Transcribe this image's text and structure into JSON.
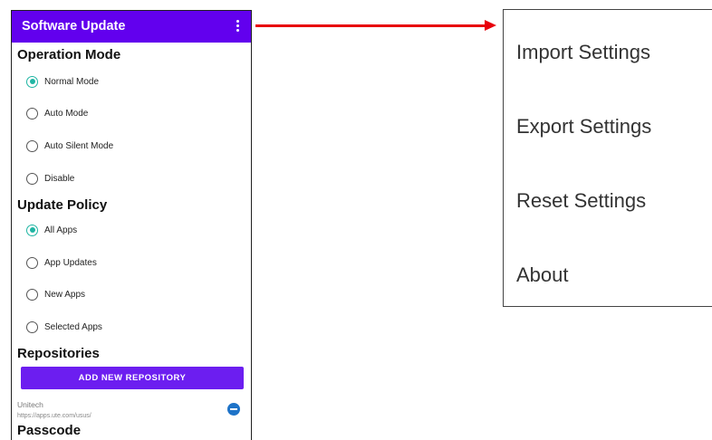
{
  "appbar": {
    "title": "Software Update",
    "menu_icon": "more-vert-icon",
    "color": "#6200ee"
  },
  "operation_mode": {
    "title": "Operation Mode",
    "options": [
      {
        "label": "Normal Mode",
        "checked": true
      },
      {
        "label": "Auto Mode",
        "checked": false
      },
      {
        "label": "Auto Silent Mode",
        "checked": false
      },
      {
        "label": "Disable",
        "checked": false
      }
    ]
  },
  "update_policy": {
    "title": "Update Policy",
    "options": [
      {
        "label": "All Apps",
        "checked": true
      },
      {
        "label": "App Updates",
        "checked": false
      },
      {
        "label": "New Apps",
        "checked": false
      },
      {
        "label": "Selected Apps",
        "checked": false
      }
    ]
  },
  "repositories": {
    "title": "Repositories",
    "add_button_label": "ADD NEW REPOSITORY",
    "items": [
      {
        "name": "Unitech",
        "url": "https://apps.ute.com/usus/"
      }
    ]
  },
  "passcode": {
    "title": "Passcode"
  },
  "overflow_menu": {
    "items": [
      "Import Settings",
      "Export Settings",
      "Reset Settings",
      "About"
    ]
  },
  "colors": {
    "accent": "#1fb5a3",
    "arrow": "#e8000b",
    "button": "#6c1ef0"
  }
}
